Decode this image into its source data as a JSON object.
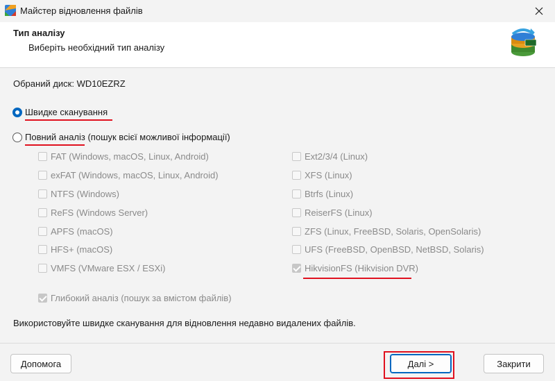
{
  "window": {
    "title": "Майстер відновлення файлів"
  },
  "header": {
    "title": "Тип аналізу",
    "subtitle": "Виберіть необхідний тип аналізу"
  },
  "disk": {
    "label": "Обраний диск: WD10EZRZ"
  },
  "scan_modes": {
    "quick": "Швидке сканування",
    "full": "Повний аналіз (пошук всієї можливої інформації)"
  },
  "filesystems_left": [
    "FAT (Windows, macOS, Linux, Android)",
    "exFAT (Windows, macOS, Linux, Android)",
    "NTFS (Windows)",
    "ReFS (Windows Server)",
    "APFS (macOS)",
    "HFS+ (macOS)",
    "VMFS (VMware ESX / ESXi)"
  ],
  "filesystems_right": [
    "Ext2/3/4 (Linux)",
    "XFS (Linux)",
    "Btrfs (Linux)",
    "ReiserFS (Linux)",
    "ZFS (Linux, FreeBSD, Solaris, OpenSolaris)",
    "UFS (FreeBSD, OpenBSD, NetBSD, Solaris)",
    "HikvisionFS (Hikvision DVR)"
  ],
  "deep_analysis": "Глибокий аналіз (пошук за вмістом файлів)",
  "hint": "Використовуйте швидке сканування для відновлення недавно видалених файлів.",
  "buttons": {
    "help": "Допомога",
    "next": "Далі >",
    "close": "Закрити"
  },
  "colors": {
    "accent": "#0067c0",
    "highlight": "#e0101e"
  }
}
